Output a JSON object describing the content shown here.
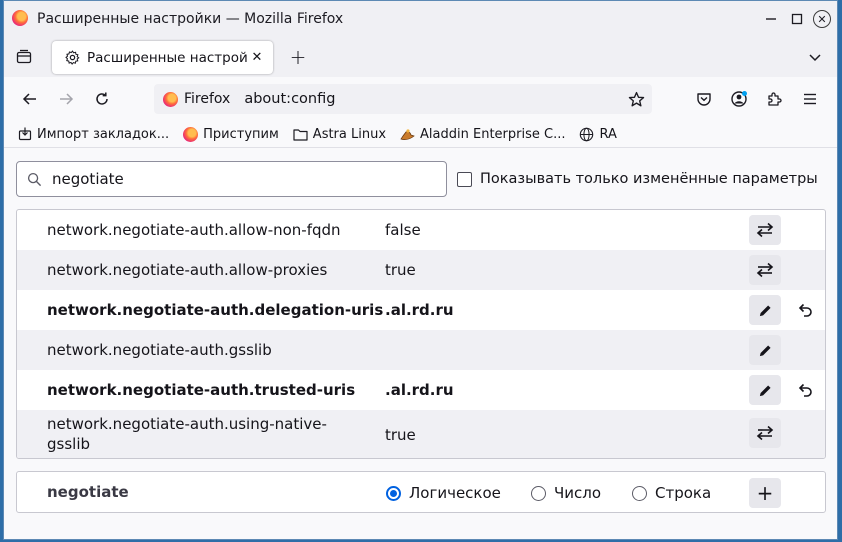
{
  "window": {
    "title": "Расширенные настройки — Mozilla Firefox",
    "controls": {
      "minimize": "–",
      "maximize": "□",
      "close": "✕"
    }
  },
  "tabs": [
    {
      "title": "Расширенные настройки",
      "icon": "gear-icon",
      "close": "✕"
    }
  ],
  "new_tab": "+",
  "navbar": {
    "identity_label": "Firefox",
    "url": "about:config"
  },
  "bookmarks": [
    {
      "label": "Импорт закладок...",
      "icon": "import-icon"
    },
    {
      "label": "Приступим",
      "icon": "firefox-icon"
    },
    {
      "label": "Astra Linux",
      "icon": "folder-icon"
    },
    {
      "label": "Aladdin Enterprise C...",
      "icon": "aladdin-icon"
    },
    {
      "label": "RA",
      "icon": "globe-icon"
    }
  ],
  "search": {
    "value": "negotiate",
    "modified_only_label": "Показывать только изменённые параметры"
  },
  "prefs": [
    {
      "name": "network.negotiate-auth.allow-non-fqdn",
      "value": "false",
      "modified": false,
      "action": "toggle"
    },
    {
      "name": "network.negotiate-auth.allow-proxies",
      "value": "true",
      "modified": false,
      "action": "toggle"
    },
    {
      "name": "network.negotiate-auth.delegation-uris",
      "value": ".al.rd.ru",
      "modified": true,
      "action": "edit"
    },
    {
      "name": "network.negotiate-auth.gsslib",
      "value": "",
      "modified": false,
      "action": "edit"
    },
    {
      "name": "network.negotiate-auth.trusted-uris",
      "value": ".al.rd.ru",
      "modified": true,
      "action": "edit"
    },
    {
      "name_line1": "network.negotiate-auth.using-native-",
      "name_line2": "gsslib",
      "value": "true",
      "modified": false,
      "action": "toggle"
    }
  ],
  "add_pref": {
    "name": "negotiate",
    "types": [
      {
        "label": "Логическое",
        "checked": true
      },
      {
        "label": "Число",
        "checked": false
      },
      {
        "label": "Строка",
        "checked": false
      }
    ],
    "add_label": "+"
  },
  "colors": {
    "accent": "#0061e0",
    "desktop": "#2e6ea8",
    "chrome": "#f0f0f4"
  }
}
